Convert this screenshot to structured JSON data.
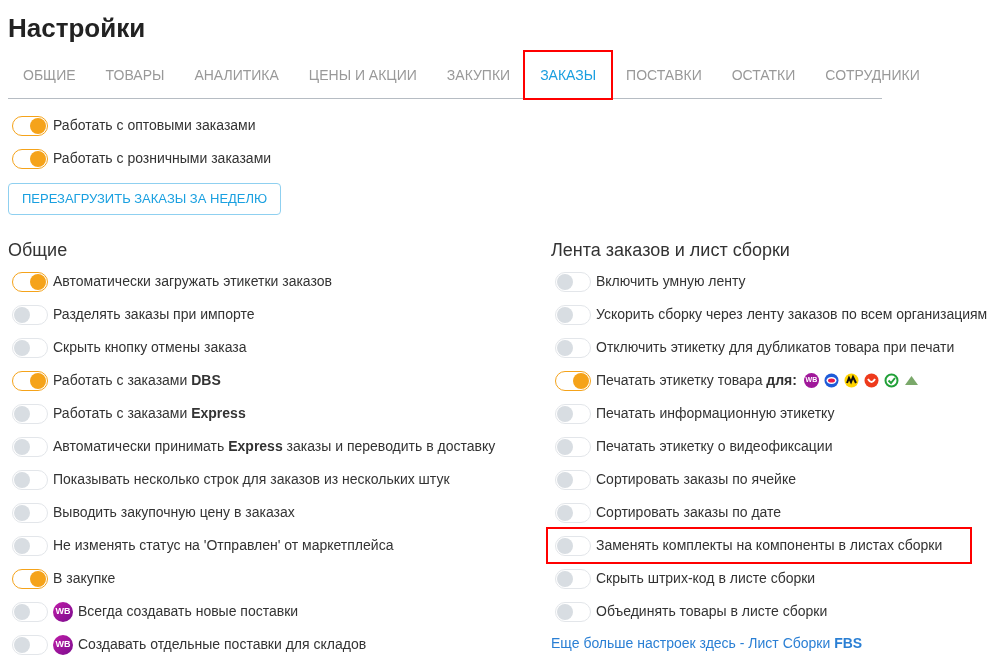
{
  "title": "Настройки",
  "tabs": [
    {
      "label": "ОБЩИЕ",
      "selected": false,
      "highlighted": false
    },
    {
      "label": "ТОВАРЫ",
      "selected": false,
      "highlighted": false
    },
    {
      "label": "АНАЛИТИКА",
      "selected": false,
      "highlighted": false
    },
    {
      "label": "ЦЕНЫ И АКЦИИ",
      "selected": false,
      "highlighted": false
    },
    {
      "label": "ЗАКУПКИ",
      "selected": false,
      "highlighted": false
    },
    {
      "label": "ЗАКАЗЫ",
      "selected": true,
      "highlighted": true
    },
    {
      "label": "ПОСТАВКИ",
      "selected": false,
      "highlighted": false
    },
    {
      "label": "ОСТАТКИ",
      "selected": false,
      "highlighted": false
    },
    {
      "label": "СОТРУДНИКИ",
      "selected": false,
      "highlighted": false
    }
  ],
  "top_toggles": [
    {
      "label": "Работать с оптовыми заказами",
      "on": true
    },
    {
      "label": "Работать с розничными заказами",
      "on": true
    }
  ],
  "reload_button": "ПЕРЕЗАГРУЗИТЬ ЗАКАЗЫ ЗА НЕДЕЛЮ",
  "sections": [
    {
      "heading": "Общие",
      "items": [
        {
          "label": "Автоматически загружать этикетки заказов",
          "on": true,
          "highlighted": false
        },
        {
          "label": "Разделять заказы при импорте",
          "on": false,
          "highlighted": false
        },
        {
          "label": "Скрыть кнопку отмены заказа",
          "on": false,
          "highlighted": false
        },
        {
          "label": "Работать с заказами **DBS**",
          "on": true,
          "highlighted": false
        },
        {
          "label": "Работать с заказами **Express**",
          "on": false,
          "highlighted": false
        },
        {
          "label": "Автоматически принимать **Express** заказы и переводить в доставку",
          "on": false,
          "highlighted": false
        },
        {
          "label": "Показывать несколько строк для заказов из нескольких штук",
          "on": false,
          "highlighted": false
        },
        {
          "label": "Выводить закупочную цену в заказах",
          "on": false,
          "highlighted": false
        },
        {
          "label": "Не изменять статус на 'Отправлен' от маркетплейса",
          "on": false,
          "highlighted": false
        },
        {
          "label": "В закупке",
          "on": true,
          "highlighted": false
        },
        {
          "label": "Всегда создавать новые поставки",
          "on": false,
          "highlighted": false,
          "badge": "WB"
        },
        {
          "label": "Создавать отдельные поставки для складов",
          "on": false,
          "highlighted": false,
          "badge": "WB"
        }
      ]
    },
    {
      "heading": "Лента заказов и лист сборки",
      "items": [
        {
          "label": "Включить умную ленту",
          "on": false,
          "highlighted": false
        },
        {
          "label": "Ускорить сборку через ленту заказов по всем организациям",
          "on": false,
          "highlighted": false
        },
        {
          "label": "Отключить этикетку для дубликатов товара при печати",
          "on": false,
          "highlighted": false
        },
        {
          "label": "Печатать этикетку товара  **для:**",
          "on": true,
          "highlighted": false,
          "marketplaces": [
            {
              "kind": "wb",
              "text": "WB"
            },
            {
              "kind": "ring"
            },
            {
              "kind": "swirl"
            },
            {
              "kind": "smile"
            },
            {
              "kind": "check"
            },
            {
              "kind": "triangle"
            }
          ]
        },
        {
          "label": "Печатать информационную этикетку",
          "on": false,
          "highlighted": false
        },
        {
          "label": "Печатать этикетку о видеофиксации",
          "on": false,
          "highlighted": false
        },
        {
          "label": "Сортировать заказы по ячейке",
          "on": false,
          "highlighted": false
        },
        {
          "label": "Сортировать заказы по дате",
          "on": false,
          "highlighted": false
        },
        {
          "label": "Заменять комплекты на компоненты в листах сборки",
          "on": false,
          "highlighted": true
        },
        {
          "label": "Скрыть штрих-код в листе сборки",
          "on": false,
          "highlighted": false
        },
        {
          "label": "Объединять товары в листе сборки",
          "on": false,
          "highlighted": false
        }
      ],
      "link": "Еще больше настроек здесь - Лист Сборки **FBS**"
    }
  ]
}
